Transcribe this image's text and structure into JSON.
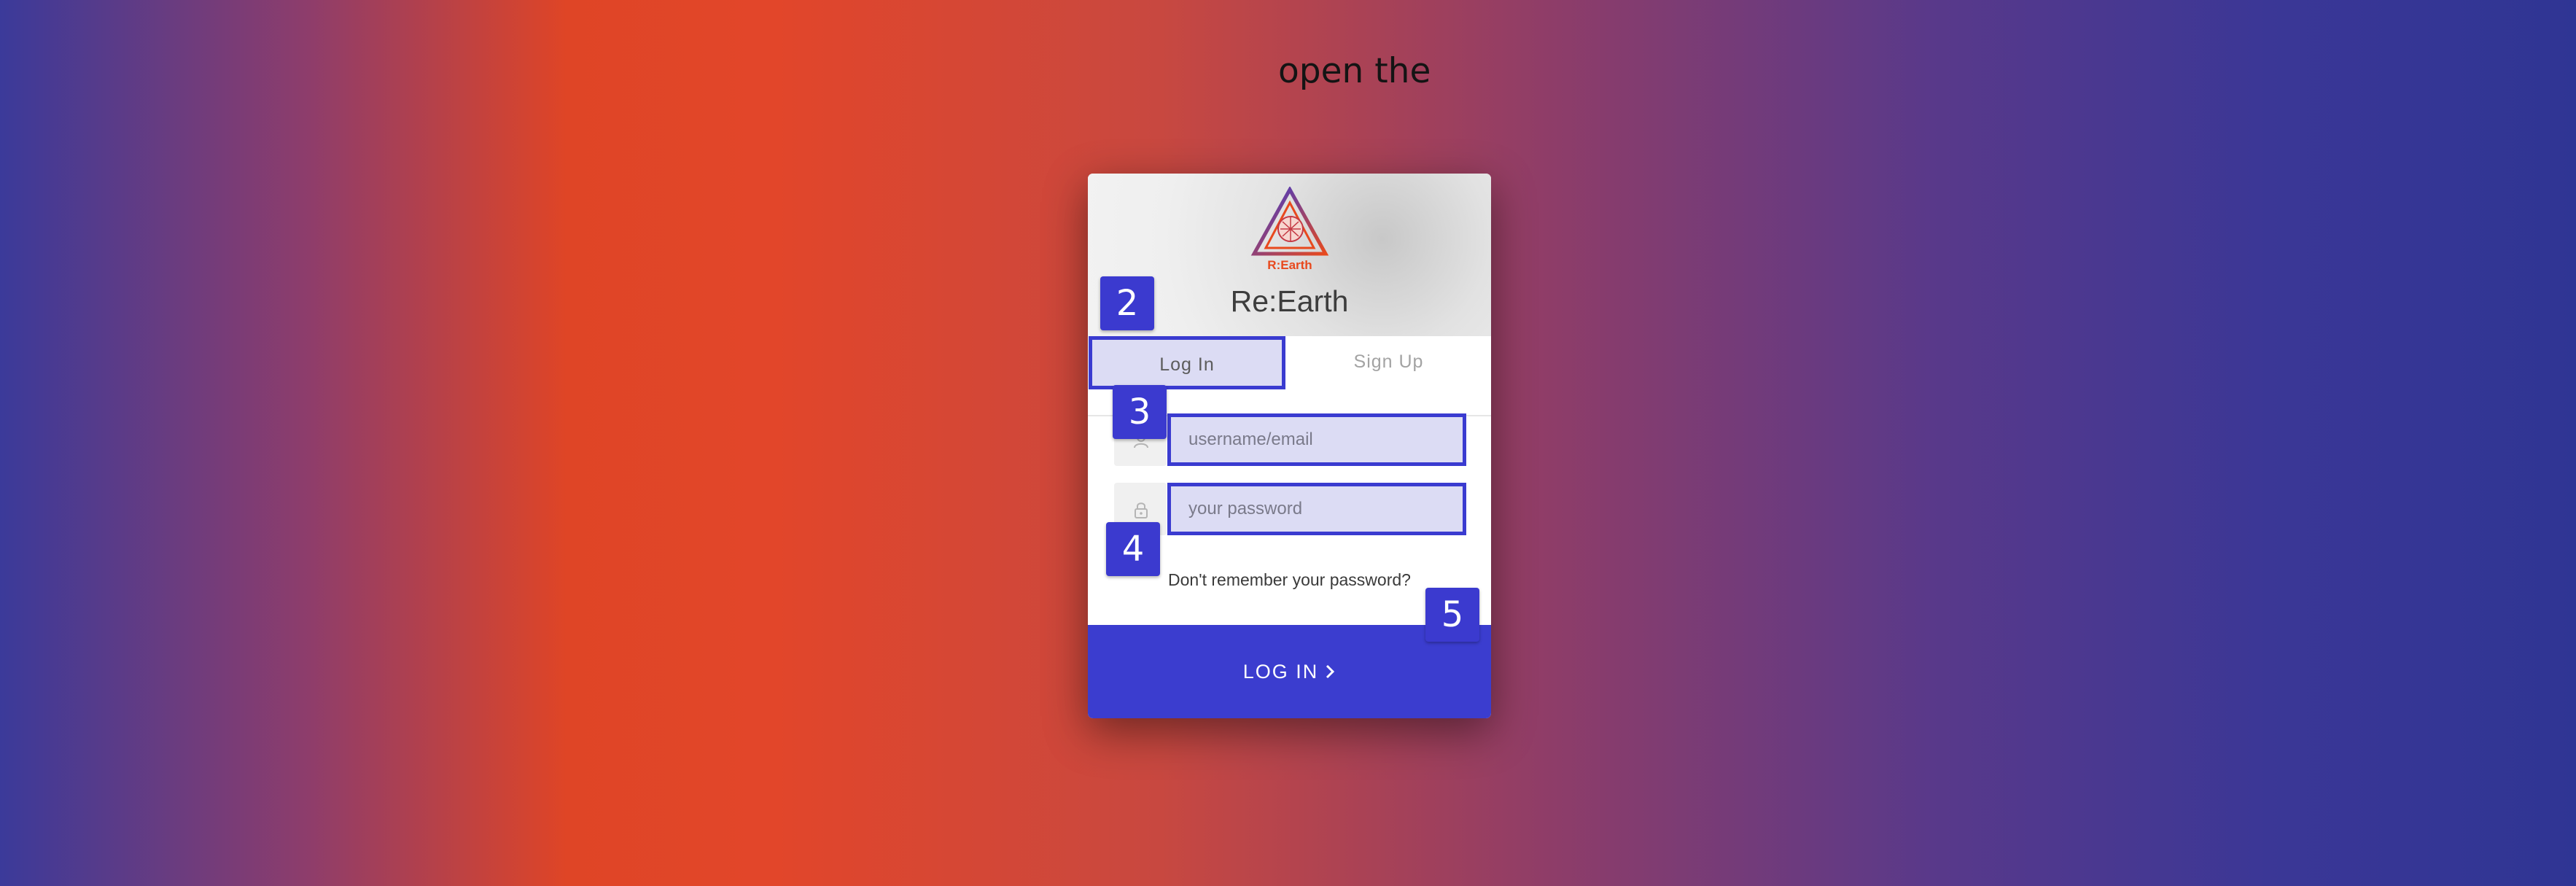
{
  "page": {
    "headline": "open the"
  },
  "brand": {
    "logo_text": "R:Earth",
    "title": "Re:Earth"
  },
  "tabs": [
    {
      "label": "Log In",
      "active": true
    },
    {
      "label": "Sign Up",
      "active": false
    }
  ],
  "form": {
    "username_placeholder": "username/email",
    "password_placeholder": "your password",
    "forgot_label": "Don't remember your password?",
    "submit_label": "LOG IN"
  },
  "markers": [
    "2",
    "3",
    "4",
    "5"
  ],
  "colors": {
    "accent": "#3b3dcf",
    "highlight_fill": "#dcdcf4",
    "logo_orange": "#e8491d",
    "logo_blue": "#3b3acf"
  },
  "icons": {
    "user": "user-icon",
    "lock": "lock-icon",
    "chevron": "chevron-right-icon"
  }
}
